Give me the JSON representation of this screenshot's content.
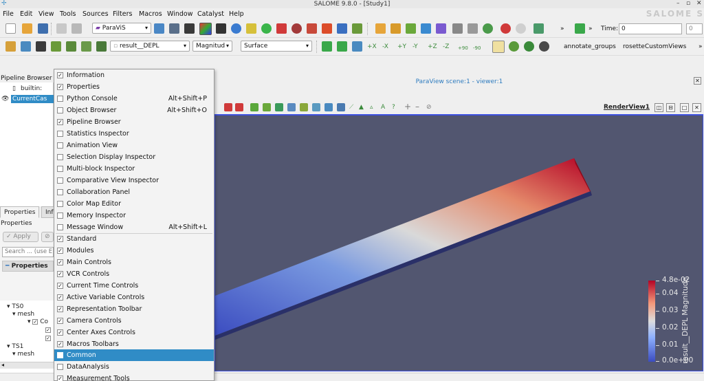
{
  "window": {
    "title": "SALOME 9.8.0 - [Study1]",
    "controls": [
      "–",
      "▫",
      "✕"
    ]
  },
  "menubar": {
    "items": [
      "File",
      "Edit",
      "View",
      "Tools",
      "Sources",
      "Filters",
      "Macros",
      "Window",
      "Catalyst",
      "Help"
    ],
    "brand": "SALOME S"
  },
  "toolbar1": {
    "module_combo": "ParaViS",
    "more1": "»",
    "more2": "»",
    "time_label": "Time:",
    "time_value": "0",
    "time_index": "0"
  },
  "toolbar2": {
    "variable_combo": "result__DEPL",
    "component_combo": "Magnitud",
    "representation_combo": "Surface",
    "macro1": "annotate_groups",
    "macro2": "rosetteCustomViews",
    "more": "»",
    "camera_labels": [
      "+X",
      "-X",
      "+Y",
      "-Y",
      "+Z",
      "-Z",
      "+90",
      "-90"
    ]
  },
  "pipeline": {
    "header": "Pipeline Browser",
    "builtin": "builtin:",
    "item": "CurrentCas"
  },
  "properties": {
    "tabs": [
      "Properties",
      "Inf"
    ],
    "label": "Properties",
    "apply": "Apply",
    "search_placeholder": "Search ... (use E",
    "section": "Properties",
    "tree": [
      {
        "label": "TS0",
        "indent": 0
      },
      {
        "label": "mesh",
        "indent": 1
      },
      {
        "label": "Co",
        "indent": 2
      },
      {
        "label": "",
        "indent": 3
      },
      {
        "label": "",
        "indent": 3
      },
      {
        "label": "TS1",
        "indent": 0
      },
      {
        "label": "mesh",
        "indent": 1
      }
    ]
  },
  "view": {
    "title": "ParaView scene:1 - viewer:1",
    "render_view_label": "RenderView1",
    "colorbar": {
      "title": "result__DEPL Magnitude",
      "ticks": [
        "4.8e-02",
        "0.04",
        "0.03",
        "0.02",
        "0.01",
        "0.0e+00"
      ]
    }
  },
  "menu": {
    "items": [
      {
        "label": "Information",
        "checked": true,
        "shortcut": ""
      },
      {
        "label": "Properties",
        "checked": true,
        "shortcut": ""
      },
      {
        "label": "Python Console",
        "checked": false,
        "shortcut": "Alt+Shift+P"
      },
      {
        "label": "Object Browser",
        "checked": false,
        "shortcut": "Alt+Shift+O"
      },
      {
        "label": "Pipeline Browser",
        "checked": true,
        "shortcut": ""
      },
      {
        "label": "Statistics Inspector",
        "checked": false,
        "shortcut": ""
      },
      {
        "label": "Animation View",
        "checked": false,
        "shortcut": ""
      },
      {
        "label": "Selection Display Inspector",
        "checked": false,
        "shortcut": ""
      },
      {
        "label": "Multi-block Inspector",
        "checked": false,
        "shortcut": ""
      },
      {
        "label": "Comparative View Inspector",
        "checked": false,
        "shortcut": ""
      },
      {
        "label": "Collaboration Panel",
        "checked": false,
        "shortcut": ""
      },
      {
        "label": "Color Map Editor",
        "checked": false,
        "shortcut": ""
      },
      {
        "label": "Memory Inspector",
        "checked": false,
        "shortcut": ""
      },
      {
        "label": "Message Window",
        "checked": false,
        "shortcut": "Alt+Shift+L"
      },
      {
        "label": "Standard",
        "checked": true,
        "shortcut": ""
      },
      {
        "label": "Modules",
        "checked": true,
        "shortcut": ""
      },
      {
        "label": "Main Controls",
        "checked": true,
        "shortcut": ""
      },
      {
        "label": "VCR Controls",
        "checked": true,
        "shortcut": ""
      },
      {
        "label": "Current Time Controls",
        "checked": true,
        "shortcut": ""
      },
      {
        "label": "Active Variable Controls",
        "checked": true,
        "shortcut": ""
      },
      {
        "label": "Representation Toolbar",
        "checked": true,
        "shortcut": ""
      },
      {
        "label": "Camera Controls",
        "checked": true,
        "shortcut": ""
      },
      {
        "label": "Center Axes Controls",
        "checked": true,
        "shortcut": ""
      },
      {
        "label": "Macros Toolbars",
        "checked": true,
        "shortcut": ""
      },
      {
        "label": "Common",
        "checked": false,
        "shortcut": "",
        "highlighted": true
      },
      {
        "label": "DataAnalysis",
        "checked": false,
        "shortcut": ""
      },
      {
        "label": "Measurement Tools",
        "checked": true,
        "shortcut": ""
      }
    ]
  },
  "colors": {
    "accent": "#308cc6",
    "viewport_bg": "#525670",
    "cold": "#3b4cc0",
    "hot": "#b40426"
  }
}
